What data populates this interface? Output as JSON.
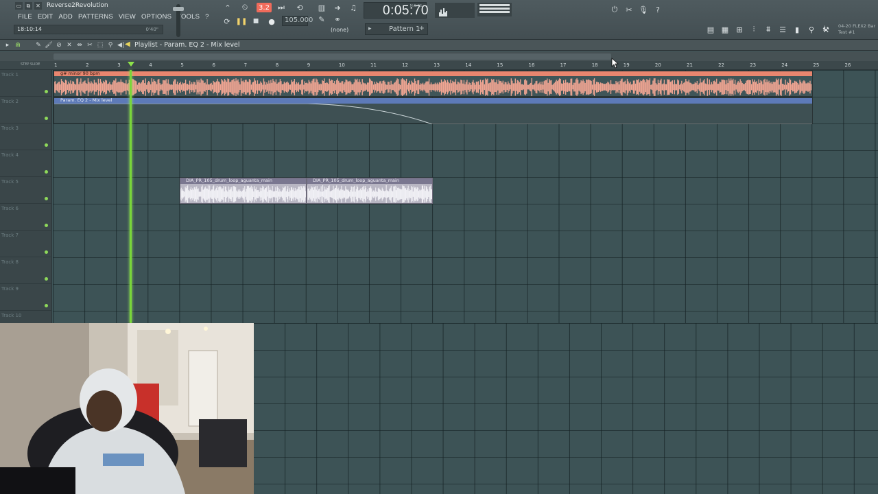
{
  "window": {
    "project_title": "Reverse2Revolution",
    "controls": [
      "▭",
      "⧉",
      "✕"
    ]
  },
  "menu": [
    "FILE",
    "EDIT",
    "ADD",
    "PATTERNS",
    "VIEW",
    "OPTIONS",
    "TOOLS",
    "?"
  ],
  "hint": {
    "time": "18:10:14",
    "value": "0'40\""
  },
  "transport": {
    "tempo_mode": "3.2",
    "bpm": "105.000",
    "time": "0:05:70",
    "time_label": "M:S:CS",
    "snap": "(none)",
    "pattern": "Pattern 1"
  },
  "news": {
    "line1": "04-20 FLEX2 Bar",
    "line2": "Test #1"
  },
  "playlist": {
    "title": "Playlist - Param. EQ 2 - Mix level",
    "ruler_label": "STEP SLIDE",
    "bars": [
      1,
      2,
      3,
      4,
      5,
      6,
      7,
      8,
      9,
      10,
      11,
      12,
      13,
      14,
      15,
      16,
      17,
      18,
      19,
      20,
      21,
      22,
      23,
      24,
      25,
      26
    ]
  },
  "tracks": [
    "Track 1",
    "Track 2",
    "Track 3",
    "Track 4",
    "Track 5",
    "Track 6",
    "Track 7",
    "Track 8",
    "Track 9",
    "Track 10"
  ],
  "clips": {
    "audio_label": "g# minor 90 bpm",
    "automation_label": "Param. EQ 2 - Mix level",
    "loop_label_1": "DIA_PR_105_drum_loop_aguanta_main",
    "loop_label_2": "DIA_PR_105_drum_loop_aguanta_main"
  },
  "colors": {
    "audio_clip": "#e8866f",
    "automation_clip": "#5d7ab8",
    "loop_clip": "#7a7790",
    "playhead": "#79d63a",
    "tempo_button": "#f06b5b"
  }
}
